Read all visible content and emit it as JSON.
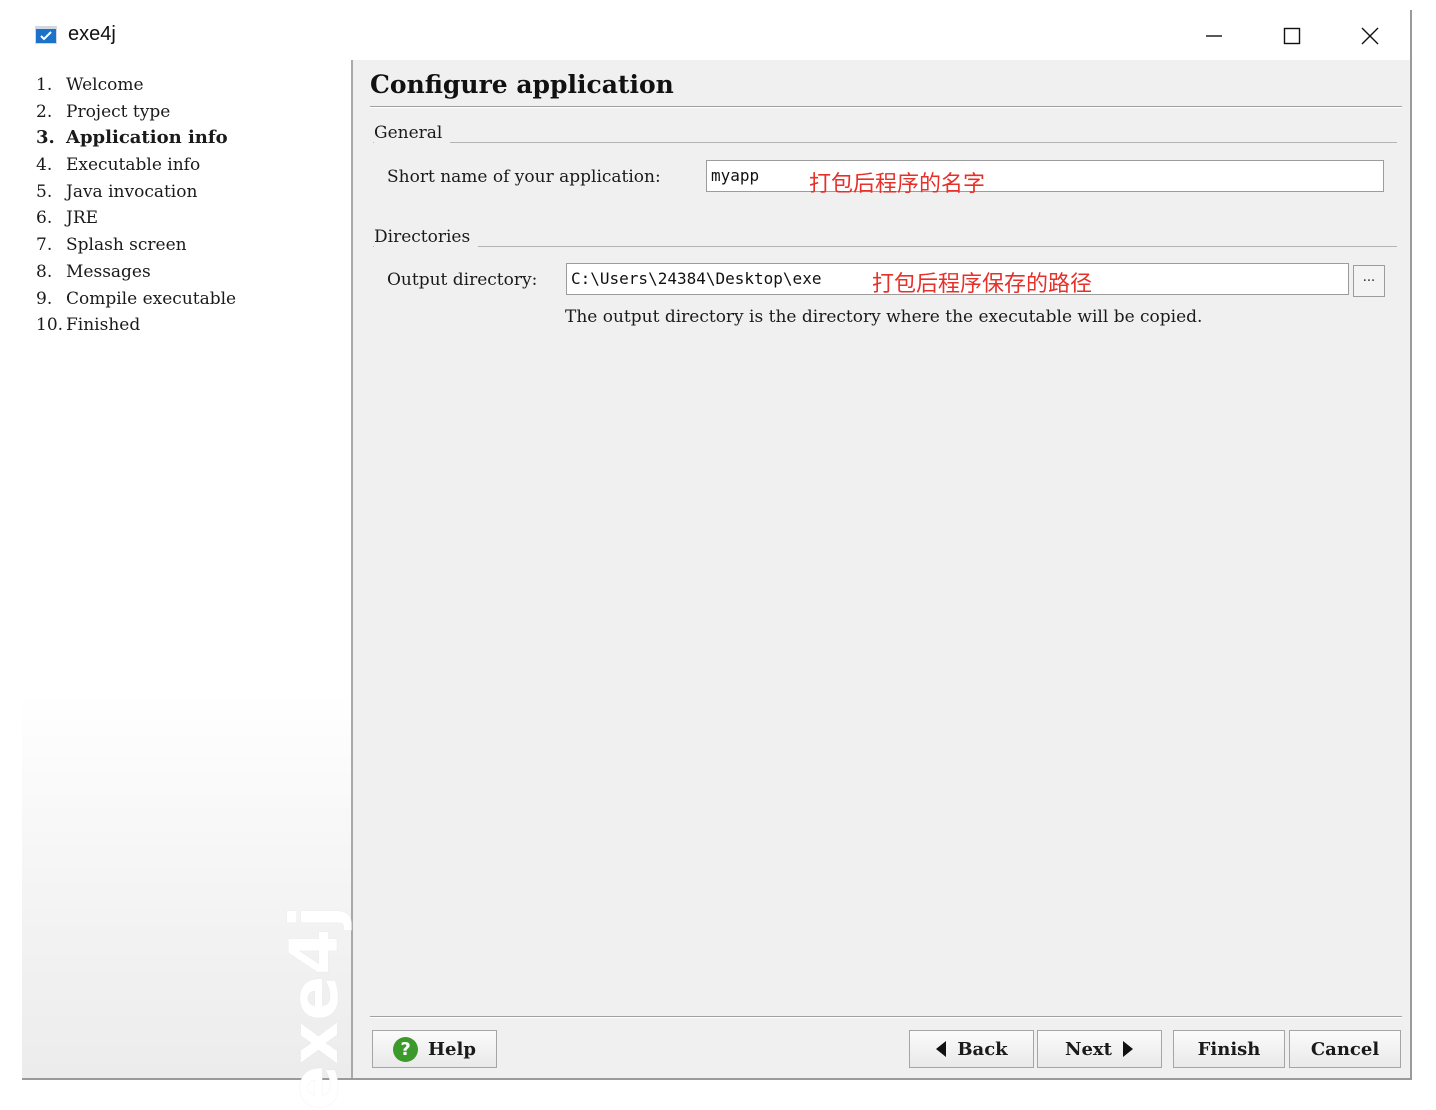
{
  "window": {
    "title": "exe4j"
  },
  "steps": [
    {
      "num": "1.",
      "label": "Welcome"
    },
    {
      "num": "2.",
      "label": "Project type"
    },
    {
      "num": "3.",
      "label": "Application info"
    },
    {
      "num": "4.",
      "label": "Executable info"
    },
    {
      "num": "5.",
      "label": "Java invocation"
    },
    {
      "num": "6.",
      "label": "JRE"
    },
    {
      "num": "7.",
      "label": "Splash screen"
    },
    {
      "num": "8.",
      "label": "Messages"
    },
    {
      "num": "9.",
      "label": "Compile executable"
    },
    {
      "num": "10.",
      "label": "Finished"
    }
  ],
  "active_step": 3,
  "sidebar": {
    "watermark": "exe4j"
  },
  "main": {
    "title": "Configure application",
    "general": {
      "label": "General",
      "short_name_label": "Short name of your application:",
      "short_name_value": "myapp",
      "short_name_annotation": "打包后程序的名字"
    },
    "directories": {
      "label": "Directories",
      "output_label": "Output directory:",
      "output_value": "C:\\Users\\24384\\Desktop\\exe",
      "output_annotation": "打包后程序保存的路径",
      "browse_label": "...",
      "hint": "The output directory is the directory where the executable will be copied."
    }
  },
  "buttons": {
    "help": "Help",
    "back": "Back",
    "next": "Next",
    "finish": "Finish",
    "cancel": "Cancel"
  },
  "colors": {
    "annotation": "#e8302a",
    "help_icon": "#3c9a2a",
    "panel_bg": "#f0f0f0"
  }
}
